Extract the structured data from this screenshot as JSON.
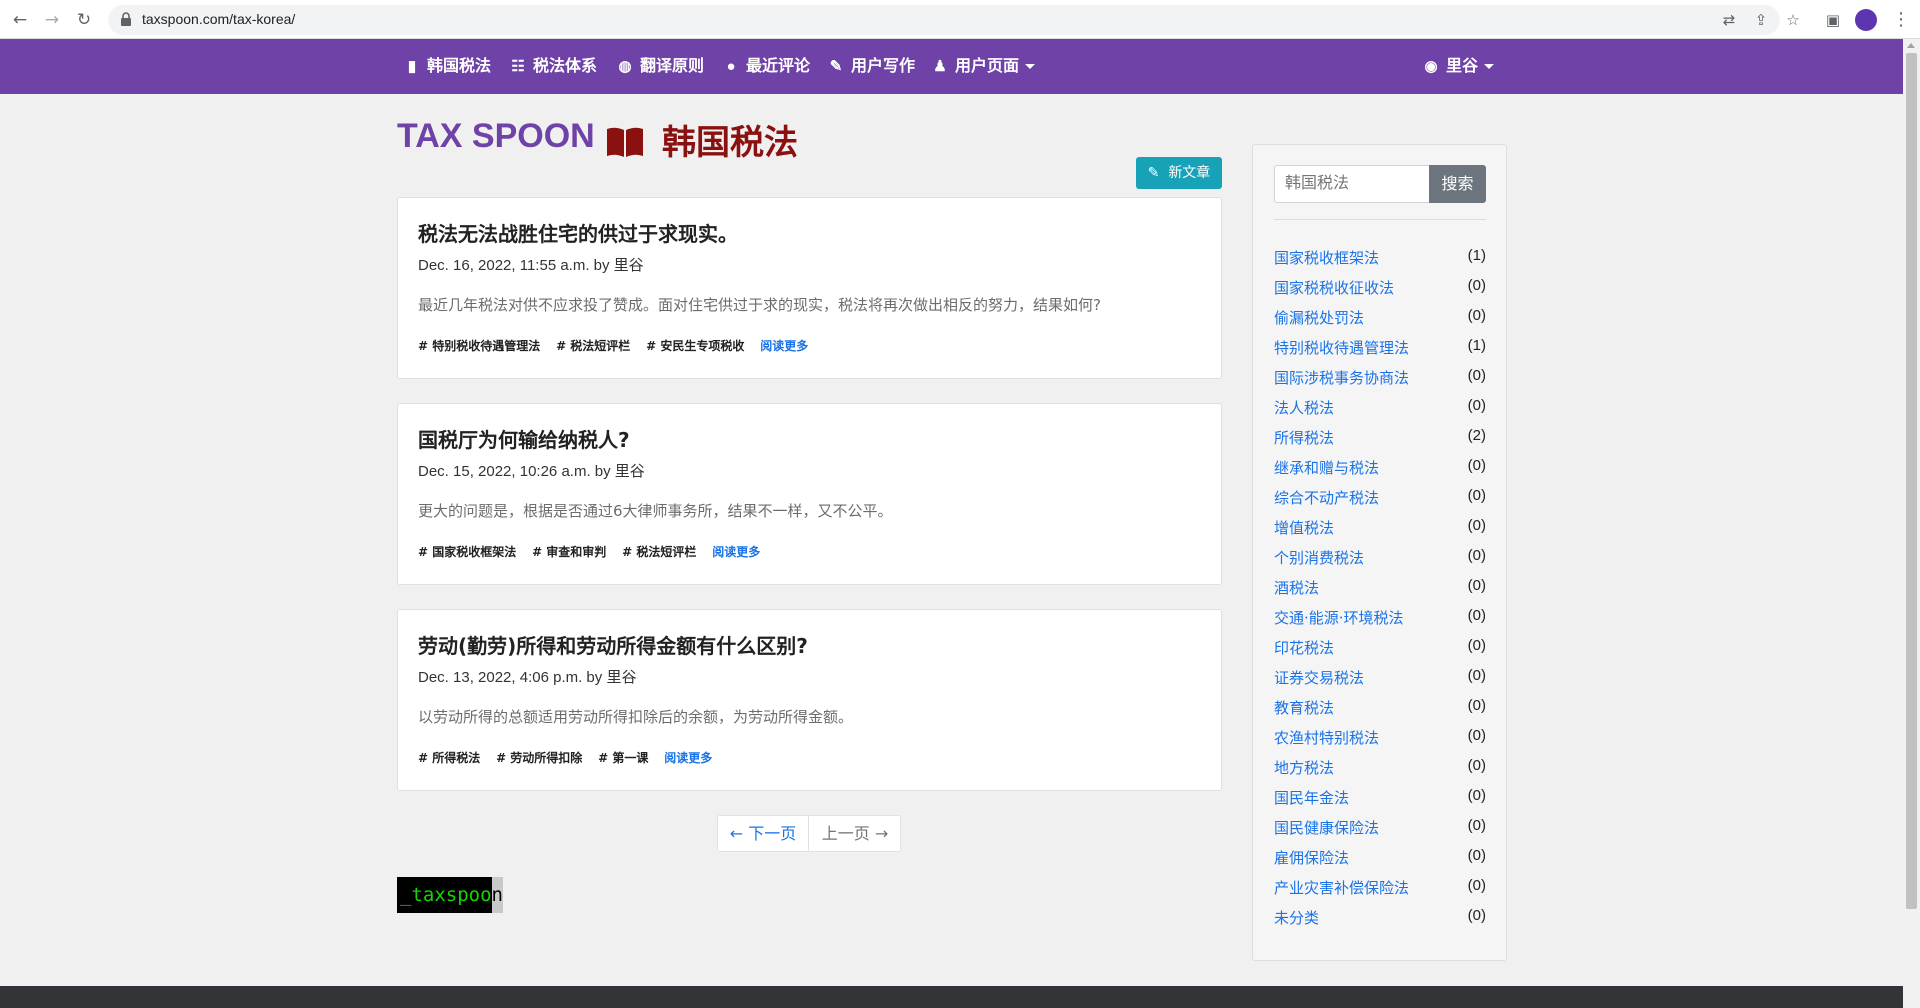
{
  "browser": {
    "url": "taxspoon.com/tax-korea/"
  },
  "nav": {
    "items": [
      {
        "label": "韩国税法",
        "icon": "book-open-icon"
      },
      {
        "label": "税法体系",
        "icon": "sitemap-icon"
      },
      {
        "label": "翻译原则",
        "icon": "globe-icon"
      },
      {
        "label": "最近评论",
        "icon": "comment-icon"
      },
      {
        "label": "用户写作",
        "icon": "pencil-icon"
      },
      {
        "label": "用户页面",
        "icon": "user-icon"
      }
    ],
    "account_label": "里谷"
  },
  "header": {
    "brand": "TAX SPOON",
    "section_title": "韩国税法"
  },
  "new_post_label": "新文章",
  "posts": [
    {
      "title": "税法无法战胜住宅的供过于求现实。",
      "meta": "Dec. 16, 2022, 11:55 a.m. by 里谷",
      "excerpt": "最近几年税法对供不应求投了赞成。面对住宅供过于求的现实，税法将再次做出相反的努力，结果如何?",
      "tags": [
        "# 特别税收待遇管理法",
        "# 税法短评栏",
        "# 安民生专项税收"
      ],
      "read_more": "阅读更多"
    },
    {
      "title": "国税厅为何输给纳税人?",
      "meta": "Dec. 15, 2022, 10:26 a.m. by 里谷",
      "excerpt": "更大的问题是，根据是否通过6大律师事务所，结果不一样，又不公平。",
      "tags": [
        "# 国家税收框架法",
        "# 审查和审判",
        "# 税法短评栏"
      ],
      "read_more": "阅读更多"
    },
    {
      "title": "劳动(勤劳)所得和劳动所得金额有什么区别?",
      "meta": "Dec. 13, 2022, 4:06 p.m. by 里谷",
      "excerpt": "以劳动所得的总额适用劳动所得扣除后的余额，为劳动所得金额。",
      "tags": [
        "# 所得税法",
        "# 劳动所得扣除",
        "# 第一课"
      ],
      "read_more": "阅读更多"
    }
  ],
  "pagination": {
    "next": "← 下一页",
    "prev": "上一页 →"
  },
  "terminal_logo": {
    "text": "_taxspoo",
    "cursor": "n"
  },
  "sidebar": {
    "search_placeholder": "韩国税法",
    "search_button": "搜索",
    "categories": [
      {
        "name": "国家税收框架法",
        "count": "(1)"
      },
      {
        "name": "国家税税收征收法",
        "count": "(0)"
      },
      {
        "name": "偷漏税处罚法",
        "count": "(0)"
      },
      {
        "name": "特别税收待遇管理法",
        "count": "(1)"
      },
      {
        "name": "国际涉税事务协商法",
        "count": "(0)"
      },
      {
        "name": "法人税法",
        "count": "(0)"
      },
      {
        "name": "所得税法",
        "count": "(2)"
      },
      {
        "name": "继承和赠与税法",
        "count": "(0)"
      },
      {
        "name": "综合不动产税法",
        "count": "(0)"
      },
      {
        "name": "增值税法",
        "count": "(0)"
      },
      {
        "name": "个别消费税法",
        "count": "(0)"
      },
      {
        "name": "酒税法",
        "count": "(0)"
      },
      {
        "name": "交通·能源·环境税法",
        "count": "(0)"
      },
      {
        "name": "印花税法",
        "count": "(0)"
      },
      {
        "name": "证券交易税法",
        "count": "(0)"
      },
      {
        "name": "教育税法",
        "count": "(0)"
      },
      {
        "name": "农渔村特别税法",
        "count": "(0)"
      },
      {
        "name": "地方税法",
        "count": "(0)"
      },
      {
        "name": "国民年金法",
        "count": "(0)"
      },
      {
        "name": "国民健康保险法",
        "count": "(0)"
      },
      {
        "name": "雇佣保险法",
        "count": "(0)"
      },
      {
        "name": "产业灾害补偿保险法",
        "count": "(0)"
      },
      {
        "name": "未分类",
        "count": "(0)"
      }
    ]
  },
  "colors": {
    "nav_bg": "#6f42a8",
    "brand": "#6f42a8",
    "section_title": "#8b1010",
    "link": "#1a73e8",
    "new_post_btn": "#17a2b8",
    "search_btn": "#6c757d"
  }
}
